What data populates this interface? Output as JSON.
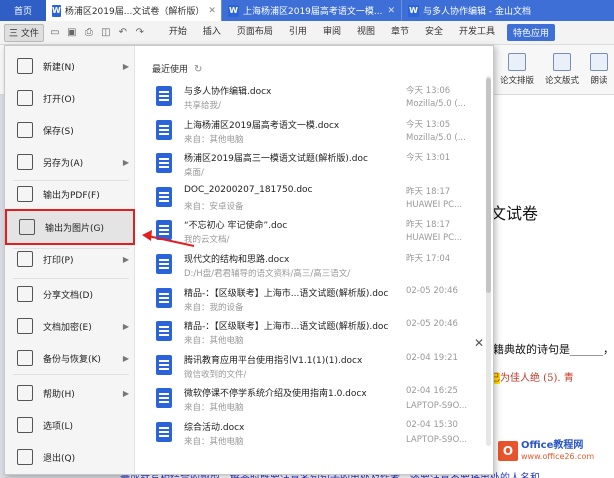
{
  "tabs": {
    "home": "首页",
    "active": "杨浦区2019届...文试卷（解析版）",
    "tab2": "上海杨浦区2019届高考语文一模...",
    "tab3": "与多人协作编辑 - 金山文档",
    "w_icon": "W"
  },
  "menubar": {
    "file": "三 文件",
    "items": [
      "开始",
      "插入",
      "页面布局",
      "引用",
      "审阅",
      "视图",
      "章节",
      "安全",
      "开发工具"
    ],
    "feature": "特色应用"
  },
  "ribbon": {
    "btn1": "论文排版",
    "btn2": "论文版式",
    "btn3": "朗读"
  },
  "file_menu": {
    "items": [
      {
        "label": "新建(N)",
        "icon": "new-doc-icon",
        "arrow": true
      },
      {
        "label": "打开(O)",
        "icon": "open-folder-icon",
        "arrow": false
      },
      {
        "label": "保存(S)",
        "icon": "save-icon",
        "arrow": false
      },
      {
        "label": "另存为(A)",
        "icon": "save-as-icon",
        "arrow": true
      },
      {
        "label": "输出为PDF(F)",
        "icon": "pdf-icon",
        "arrow": false
      },
      {
        "label": "输出为图片(G)",
        "icon": "image-export-icon",
        "arrow": false
      },
      {
        "label": "打印(P)",
        "icon": "print-icon",
        "arrow": true
      },
      {
        "label": "分享文档(D)",
        "icon": "share-icon",
        "arrow": false
      },
      {
        "label": "文档加密(E)",
        "icon": "lock-icon",
        "arrow": true
      },
      {
        "label": "备份与恢复(K)",
        "icon": "backup-icon",
        "arrow": true
      },
      {
        "label": "帮助(H)",
        "icon": "help-icon",
        "arrow": true
      },
      {
        "label": "选项(L)",
        "icon": "options-icon",
        "arrow": false
      },
      {
        "label": "退出(Q)",
        "icon": "exit-icon",
        "arrow": false
      }
    ],
    "recent_header": "最近使用",
    "recent": [
      {
        "name": "与多人协作编辑.docx",
        "path": "共享给我/",
        "date": "今天 13:06",
        "device": "Mozilla/5.0 (..."
      },
      {
        "name": "上海杨浦区2019届高考语文一模.docx",
        "path": "来自：其他电脑",
        "date": "今天 13:05",
        "device": "Mozilla/5.0 (..."
      },
      {
        "name": "杨浦区2019届高三一模语文试题(解析版).doc",
        "path": "桌面/",
        "date": "今天 13:01",
        "device": ""
      },
      {
        "name": "DOC_20200207_181750.doc",
        "path": "来自：安卓设备",
        "date": "昨天 18:17",
        "device": "HUAWEI PC..."
      },
      {
        "name": "“不忘初心 牢记使命”.doc",
        "path": "我的云文档/",
        "date": "昨天 18:17",
        "device": "HUAWEI PC..."
      },
      {
        "name": "现代文的结构和思路.docx",
        "path": "D:/H盘/君君辅导的语文资料/高三/高三语文/",
        "date": "昨天 17:04",
        "device": ""
      },
      {
        "name": "精品-：【区级联考】上海市...语文试题(解析版).doc",
        "path": "来自：我的设备",
        "date": "02-05 20:46",
        "device": ""
      },
      {
        "name": "精品-：【区级联考】上海市...语文试题(解析版).doc",
        "path": "来自：其他电脑",
        "date": "02-05 20:46",
        "device": ""
      },
      {
        "name": "腾讯教育应用平台使用指引V1.1(1)(1).docx",
        "path": "微信收到的文件/",
        "date": "02-04 19:21",
        "device": ""
      },
      {
        "name": "微软停课不停学系统介绍及使用指南1.0.docx",
        "path": "来自：其他电脑",
        "date": "02-04 16:25",
        "device": "LAPTOP-S9O..."
      },
      {
        "name": "综合活动.docx",
        "path": "来自：其他电脑",
        "date": "02-04 15:30",
        "device": "LAPTOP-S9O..."
      }
    ]
  },
  "document": {
    "title_part": "文试卷",
    "line1_pre": "籍典故的诗句是______，",
    "line2_pre": "弦",
    "line2_hl": "已",
    "line2_post": "为佳人绝   (5). 青",
    "bottom": "最或默写相结合的题型，解答时既要注意名句句子的出处及作者，还要注意不要将出处的人名和"
  },
  "watermark": {
    "logo": "O",
    "line1": "Office教程网",
    "url": "www.office26.com"
  },
  "colors": {
    "accent": "#3d6fd7",
    "highlight_border": "#e02020"
  }
}
